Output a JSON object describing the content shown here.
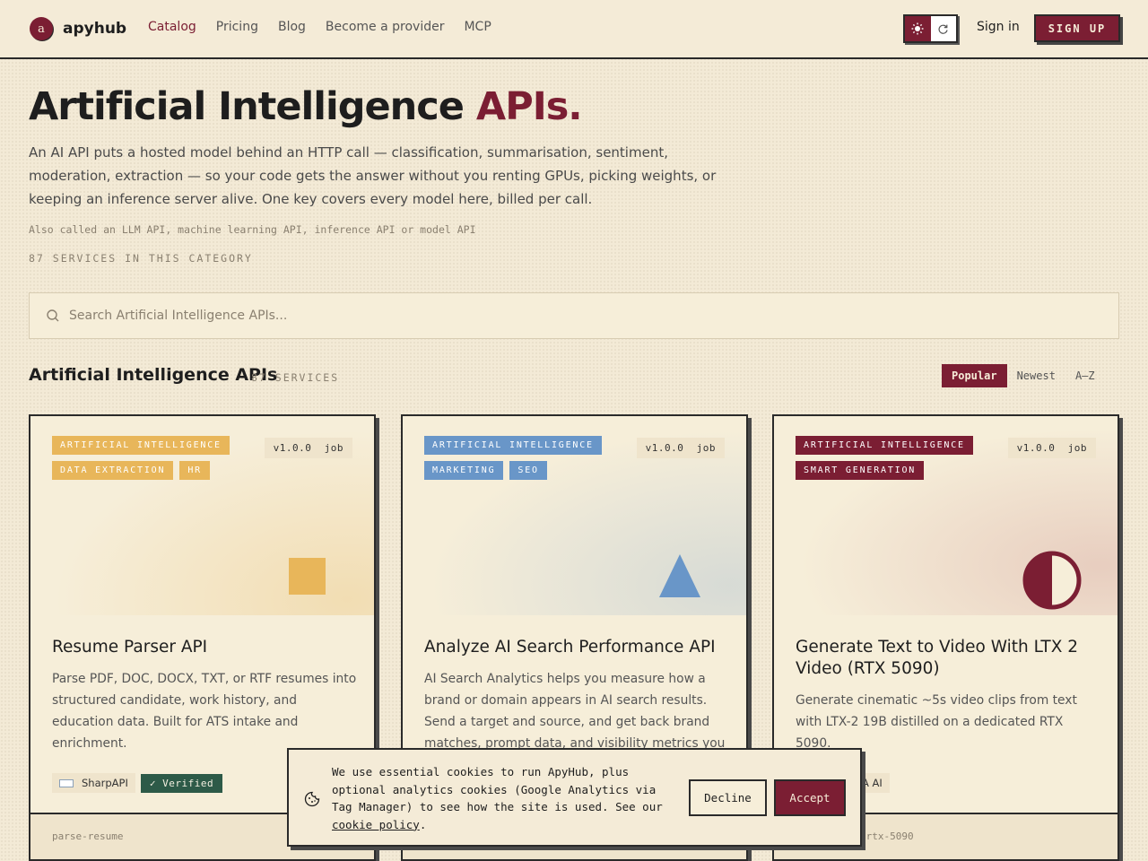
{
  "header": {
    "logo_letter": "a",
    "brand": "apyhub",
    "nav": [
      {
        "label": "Catalog",
        "active": true
      },
      {
        "label": "Pricing"
      },
      {
        "label": "Blog"
      },
      {
        "label": "Become a provider"
      },
      {
        "label": "MCP"
      }
    ],
    "signin": "Sign in",
    "signup": "SIGN UP"
  },
  "hero": {
    "title_main": "Artificial Intelligence ",
    "title_accent": "APIs.",
    "description": "An AI API puts a hosted model behind an HTTP call — classification, summarisation, sentiment, moderation, extraction — so your code gets the answer without you renting GPUs, picking weights, or keeping an inference server alive. One key covers every model here, billed per call.",
    "aka": "Also called an LLM API, machine learning API, inference API or model API",
    "count": "87 SERVICES IN THIS CATEGORY"
  },
  "search": {
    "placeholder": "Search Artificial Intelligence APIs..."
  },
  "section": {
    "title": "Artificial Intelligence APIs",
    "count": "87 SERVICES",
    "sorts": [
      "Popular",
      "Newest",
      "A–Z"
    ]
  },
  "cards": [
    {
      "tags": [
        "ARTIFICIAL INTELLIGENCE",
        "DATA EXTRACTION",
        "HR"
      ],
      "tag_color": "#e8b65a",
      "version": "v1.0.0  job",
      "title": "Resume Parser API",
      "description": "Parse PDF, DOC, DOCX, TXT, or RTF resumes into structured candidate, work history, and education data. Built for ATS intake and enrichment.",
      "provider": "SharpAPI",
      "verified": "✓ Verified",
      "slug": "parse-resume"
    },
    {
      "tags": [
        "ARTIFICIAL INTELLIGENCE",
        "MARKETING",
        "SEO"
      ],
      "tag_color": "#6996c8",
      "version": "v1.0.0  job",
      "title": "Analyze AI Search Performance API",
      "description": "AI Search Analytics helps you measure how a brand or domain appears in AI search results. Send a target and source, and get back brand matches, prompt data, and visibility metrics you can use t..."
    },
    {
      "tags": [
        "ARTIFICIAL INTELLIGENCE",
        "SMART GENERATION"
      ],
      "tag_color": "#7b1e33",
      "version": "v1.0.0  job",
      "title": "Generate Text to Video With LTX 2 Video (RTX 5090)",
      "description": "Generate cinematic ~5s video clips from text with LTX-2 19B distilled on a dedicated RTX 5090.",
      "provider_partial": "A AI",
      "slug_partial": "-rtx-5090"
    }
  ],
  "cookie": {
    "text": "We use essential cookies to run ApyHub, plus optional analytics cookies (Google Analytics via Tag Manager) to see how the site is used. See our ",
    "link": "cookie policy",
    "suffix": ".",
    "decline": "Decline",
    "accept": "Accept"
  },
  "colors": {
    "accent": "#7b1e33",
    "verified": "#2d5a48",
    "background": "#f3ead6"
  }
}
